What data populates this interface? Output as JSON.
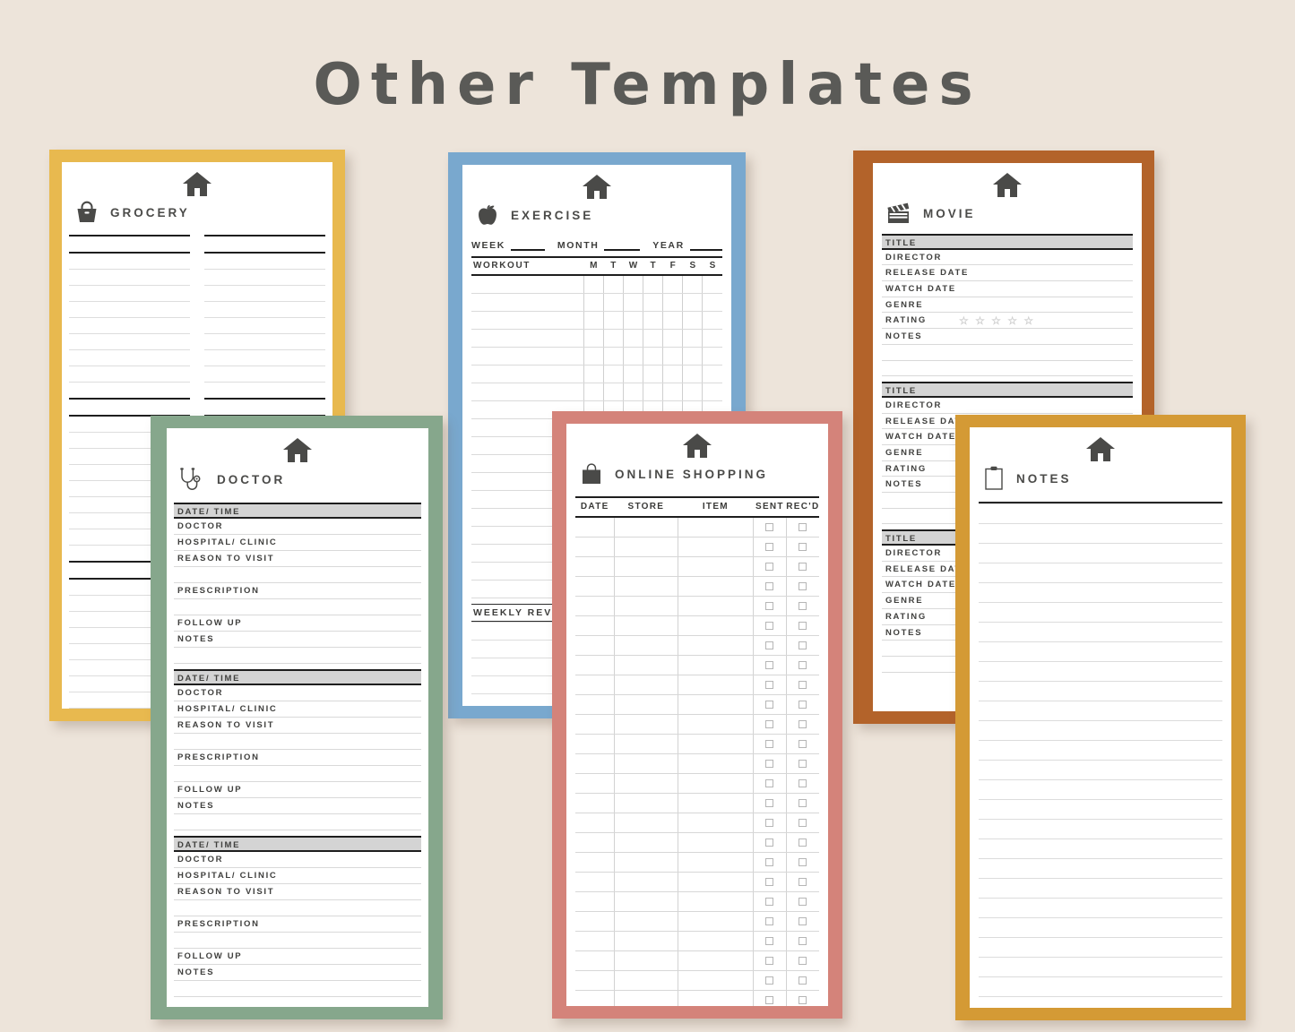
{
  "page": {
    "title": "Other Templates",
    "background_color": "#EDE4DA",
    "title_color": "#5A5A57"
  },
  "cards": {
    "grocery": {
      "name": "Grocery",
      "title": "GROCERY",
      "icon": "shopping-basket-icon",
      "home_icon": "house-icon",
      "border_color": "#E8B94F",
      "columns": 2,
      "line_pattern": [
        "dark",
        "dark",
        "light",
        "light",
        "light",
        "light",
        "light",
        "light",
        "light",
        "light",
        "dark",
        "dark",
        "light",
        "light",
        "light",
        "light",
        "light",
        "light",
        "light",
        "light",
        "dark",
        "dark",
        "light",
        "light",
        "light",
        "light",
        "light",
        "light",
        "light",
        "light",
        "dark"
      ]
    },
    "exercise": {
      "name": "Exercise",
      "title": "EXERCISE",
      "icon": "apple-icon",
      "home_icon": "house-icon",
      "border_color": "#79A8CE",
      "fields": [
        {
          "label": "WEEK"
        },
        {
          "label": "MONTH"
        },
        {
          "label": "YEAR"
        }
      ],
      "table": {
        "first_header": "WORKOUT",
        "day_headers": [
          "M",
          "T",
          "W",
          "T",
          "F",
          "S",
          "S"
        ],
        "row_count": 18
      },
      "weekly_review_label": "WEEKLY REVIEW",
      "weekly_review_lines": 7
    },
    "movie": {
      "name": "Movie",
      "title": "MOVIE",
      "icon": "clapperboard-icon",
      "home_icon": "house-icon",
      "border_color": "#B3632A",
      "section_count": 3,
      "fields": [
        {
          "label": "TITLE",
          "style": "head"
        },
        {
          "label": "DIRECTOR",
          "style": "plain"
        },
        {
          "label": "RELEASE DATE",
          "style": "plain"
        },
        {
          "label": "WATCH DATE",
          "style": "plain"
        },
        {
          "label": "GENRE",
          "style": "plain"
        },
        {
          "label": "RATING",
          "style": "rating"
        },
        {
          "label": "NOTES",
          "style": "plain"
        },
        {
          "label": "",
          "style": "blank"
        },
        {
          "label": "",
          "style": "blank"
        }
      ],
      "rating_stars": "☆ ☆ ☆ ☆ ☆"
    },
    "doctor": {
      "name": "Doctor",
      "title": "DOCTOR",
      "icon": "stethoscope-icon",
      "home_icon": "house-icon",
      "border_color": "#86A78C",
      "section_count": 3,
      "fields": [
        {
          "label": "DATE/ TIME",
          "style": "head"
        },
        {
          "label": "DOCTOR",
          "style": "plain"
        },
        {
          "label": "HOSPITAL/ CLINIC",
          "style": "plain"
        },
        {
          "label": "REASON TO VISIT",
          "style": "plain"
        },
        {
          "label": "",
          "style": "blank"
        },
        {
          "label": "PRESCRIPTION",
          "style": "plain"
        },
        {
          "label": "",
          "style": "blank"
        },
        {
          "label": "FOLLOW UP",
          "style": "plain"
        },
        {
          "label": "NOTES",
          "style": "plain"
        },
        {
          "label": "",
          "style": "blank"
        }
      ]
    },
    "online_shopping": {
      "name": "Online Shopping",
      "title": "ONLINE SHOPPING",
      "icon": "shopping-bag-icon",
      "home_icon": "house-icon",
      "border_color": "#D4837A",
      "table": {
        "headers": [
          "DATE",
          "STORE",
          "ITEM",
          "SENT",
          "REC'D"
        ],
        "row_count": 26,
        "checkbox_columns": [
          "SENT",
          "REC'D"
        ]
      }
    },
    "notes": {
      "name": "Notes",
      "title": "NOTES",
      "icon": "clipboard-icon",
      "home_icon": "house-icon",
      "border_color": "#D49A35",
      "line_count": 26
    }
  }
}
